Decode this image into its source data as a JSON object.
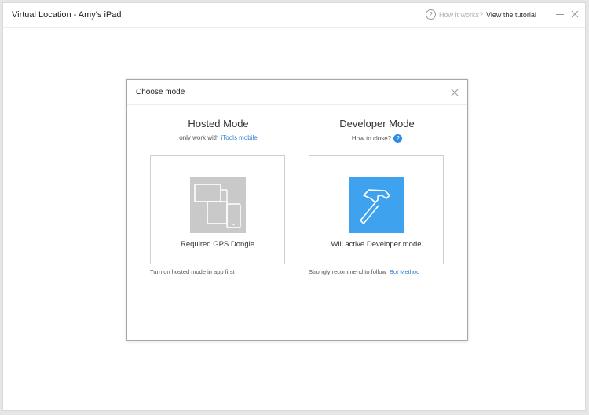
{
  "window": {
    "title": "Virtual Location - Amy's iPad",
    "help_icon": "?",
    "how_it_works": "How it works?",
    "view_tutorial": "View the tutorial"
  },
  "dialog": {
    "title": "Choose mode",
    "hosted": {
      "title": "Hosted Mode",
      "subtitle_prefix": "only work with",
      "subtitle_link": "iTools mobile",
      "card_label": "Required GPS Dongle",
      "note": "Turn on hosted mode in app first",
      "icon": "devices-icon"
    },
    "developer": {
      "title": "Developer Mode",
      "subtitle": "How to close?",
      "help_badge": "?",
      "card_label": "Will active Developer mode",
      "note_prefix": "Strongly recommend to follow",
      "note_link": "Bot Method",
      "icon": "hammer-icon"
    }
  },
  "colors": {
    "accent": "#2c8be6",
    "link": "#2f7fd1",
    "developer_tile": "#3fa2ee",
    "hosted_tile": "#c9c9c9"
  }
}
